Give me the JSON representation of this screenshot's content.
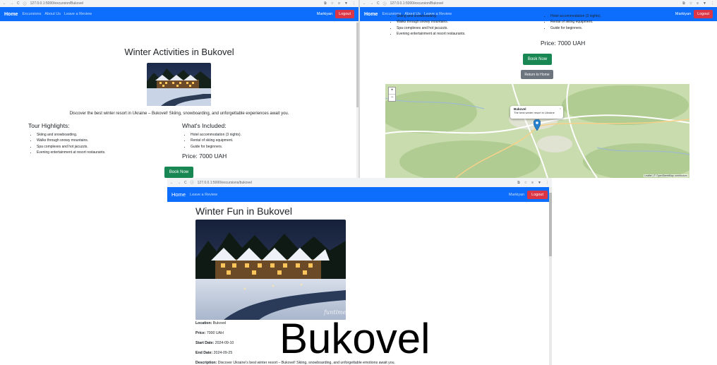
{
  "browser": {
    "url_top": "127.0.0.1:5000/excursion/Bukovel",
    "url_bottom": "127.0.0.1:5000/excursions/bukovel"
  },
  "nav_a": {
    "brand": "Home",
    "links": [
      "Excursions",
      "About Us",
      "Leave a Review"
    ],
    "user": "Markiyan",
    "logout": "Logout"
  },
  "nav_c": {
    "brand": "Home",
    "links": [
      "Leave a Review"
    ],
    "user": "Markiyan",
    "logout": "Logout"
  },
  "page_a": {
    "title": "Winter Activities in Bukovel",
    "intro": "Discover the best winter resort in Ukraine – Bukovel! Skiing, snowboarding, and unforgettable experiences await you.",
    "highlights_title": "Tour Highlights:",
    "highlights": [
      "Skiing and snowboarding.",
      "Walks through snowy mountains.",
      "Spa complexes and hot jacuzzis.",
      "Evening entertainment at resort restaurants."
    ],
    "included_title": "What's Included:",
    "included": [
      "Hotel accommodation (3 nights).",
      "Rental of skiing equipment.",
      "Guide for beginners."
    ],
    "price": "Price: 7000 UAH",
    "book_button": "Book Now"
  },
  "page_b": {
    "highlights_partial": [
      "Skiing and snowboarding.",
      "Walks through snowy mountains.",
      "Spa complexes and hot jacuzzis.",
      "Evening entertainment at resort restaurants."
    ],
    "included_partial": [
      "Hotel accommodation (3 nights).",
      "Rental of skiing equipment.",
      "Guide for beginners."
    ],
    "price": "Price: 7000 UAH",
    "book_button": "Book Now",
    "return_button": "Return to Home",
    "map_popup_title": "Bukovel",
    "map_popup_text": "The best winter resort in Ukraine",
    "map_attribution": "Leaflet | © OpenStreetMap contributors",
    "zoom_in": "+",
    "zoom_out": "−"
  },
  "page_c": {
    "title": "Winter Fun in Bukovel",
    "watermark": "funtime",
    "location_label": "Location:",
    "location_value": "Bukovel",
    "price_label": "Price:",
    "price_value": "7000 UAH",
    "start_label": "Start Date:",
    "start_value": "2024-09-10",
    "end_label": "End Date:",
    "end_value": "2024-09-25",
    "description_label": "Description:",
    "description_value": "Discover Ukraine's best winter resort – Bukovel! Skiing, snowboarding, and unforgettable emotions await you."
  },
  "caption": "Bukovel",
  "colors": {
    "navbar": "#0d6efd",
    "logout": "#dc3545",
    "book": "#198754",
    "return": "#6c757d"
  },
  "icons": [
    "back-icon",
    "forward-icon",
    "reload-icon",
    "info-icon",
    "translate-icon",
    "star-icon",
    "extensions-icon",
    "download-icon",
    "menu-icon",
    "map-marker-icon"
  ]
}
